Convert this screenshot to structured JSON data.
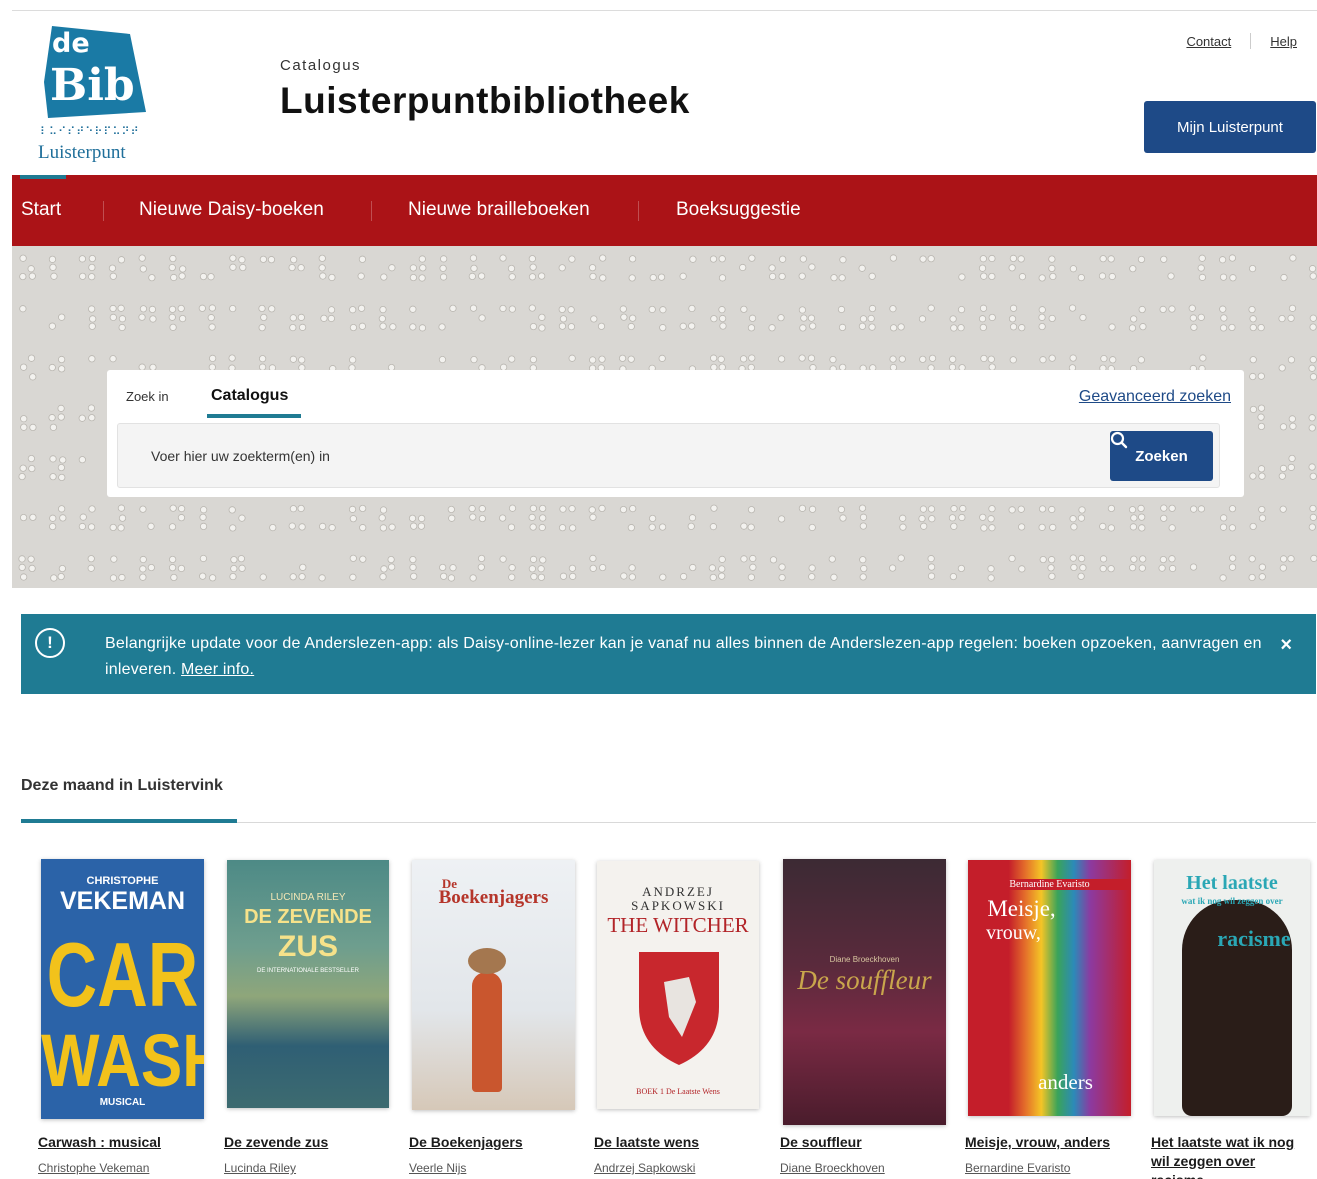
{
  "logo": {
    "mark_top": "de",
    "mark_bottom": "Bib",
    "braille": "⠇⠥⠊⠎⠞⠑⠗⠏⠥⠝⠞",
    "name": "Luisterpunt"
  },
  "header": {
    "subtitle": "Catalogus",
    "title": "Luisterpuntbibliotheek",
    "contact": "Contact",
    "help": "Help",
    "account_button": "Mijn Luisterpunt"
  },
  "nav": {
    "items": [
      "Start",
      "Nieuwe Daisy-boeken",
      "Nieuwe brailleboeken",
      "Boeksuggestie"
    ],
    "active": "Start"
  },
  "search": {
    "label": "Zoek in",
    "tab": "Catalogus",
    "advanced": "Geavanceerd zoeken",
    "placeholder": "Voer hier uw zoekterm(en) in",
    "button": "Zoeken"
  },
  "alert": {
    "text": "Belangrijke update voor de Anderslezen-app: als Daisy-online-lezer kan je vanaf nu alles binnen de Anderslezen-app regelen: boeken opzoeken, aanvragen en inleveren.",
    "link": "Meer info.",
    "close": "×"
  },
  "section": {
    "title": "Deze maand in Luistervink"
  },
  "books": [
    {
      "title": "Carwash : musical",
      "author": "Christophe Vekeman",
      "cover_bg": "#2b63a8",
      "cover_lines": [
        "CHRISTOPHE",
        "VEKEMAN",
        "CAR",
        "WASH",
        "MUSICAL"
      ]
    },
    {
      "title": "De zevende zus",
      "author": "Lucinda Riley",
      "cover_bg": "#3e7c7a",
      "cover_lines": [
        "LUCINDA RILEY",
        "DE ZEVENDE",
        "ZUS",
        "DE INTERNATIONALE BESTSELLER"
      ]
    },
    {
      "title": "De Boekenjagers",
      "author": "Veerle Nijs",
      "cover_bg": "#e8ecf0",
      "cover_lines": [
        "De",
        "Boekenjagers"
      ]
    },
    {
      "title": "De laatste wens",
      "author": "Andrzej Sapkowski",
      "cover_bg": "#f4f2ee",
      "cover_lines": [
        "ANDRZEJ",
        "SAPKOWSKI",
        "THE WITCHER",
        "BOEK 1 De Laatste Wens"
      ]
    },
    {
      "title": "De souffleur",
      "author": "Diane Broeckhoven",
      "cover_bg": "#3a2a33",
      "cover_lines": [
        "Diane Broeckhoven",
        "De souffleur"
      ]
    },
    {
      "title": "Meisje, vrouw, anders",
      "author": "Bernardine Evaristo",
      "cover_bg": "#c41e2a",
      "cover_lines": [
        "Bernardine Evaristo",
        "Meisje,",
        "vrouw,",
        "anders"
      ]
    },
    {
      "title": "Het laatste wat ik nog wil zeggen over racisme",
      "author": "",
      "cover_bg": "#eef0ee",
      "cover_lines": [
        "Het laatste",
        "wat ik nog wil zeggen over",
        "racisme"
      ]
    }
  ],
  "colors": {
    "nav_red": "#ab1317",
    "brand_blue": "#1e4a87",
    "teal": "#1f7b93"
  }
}
